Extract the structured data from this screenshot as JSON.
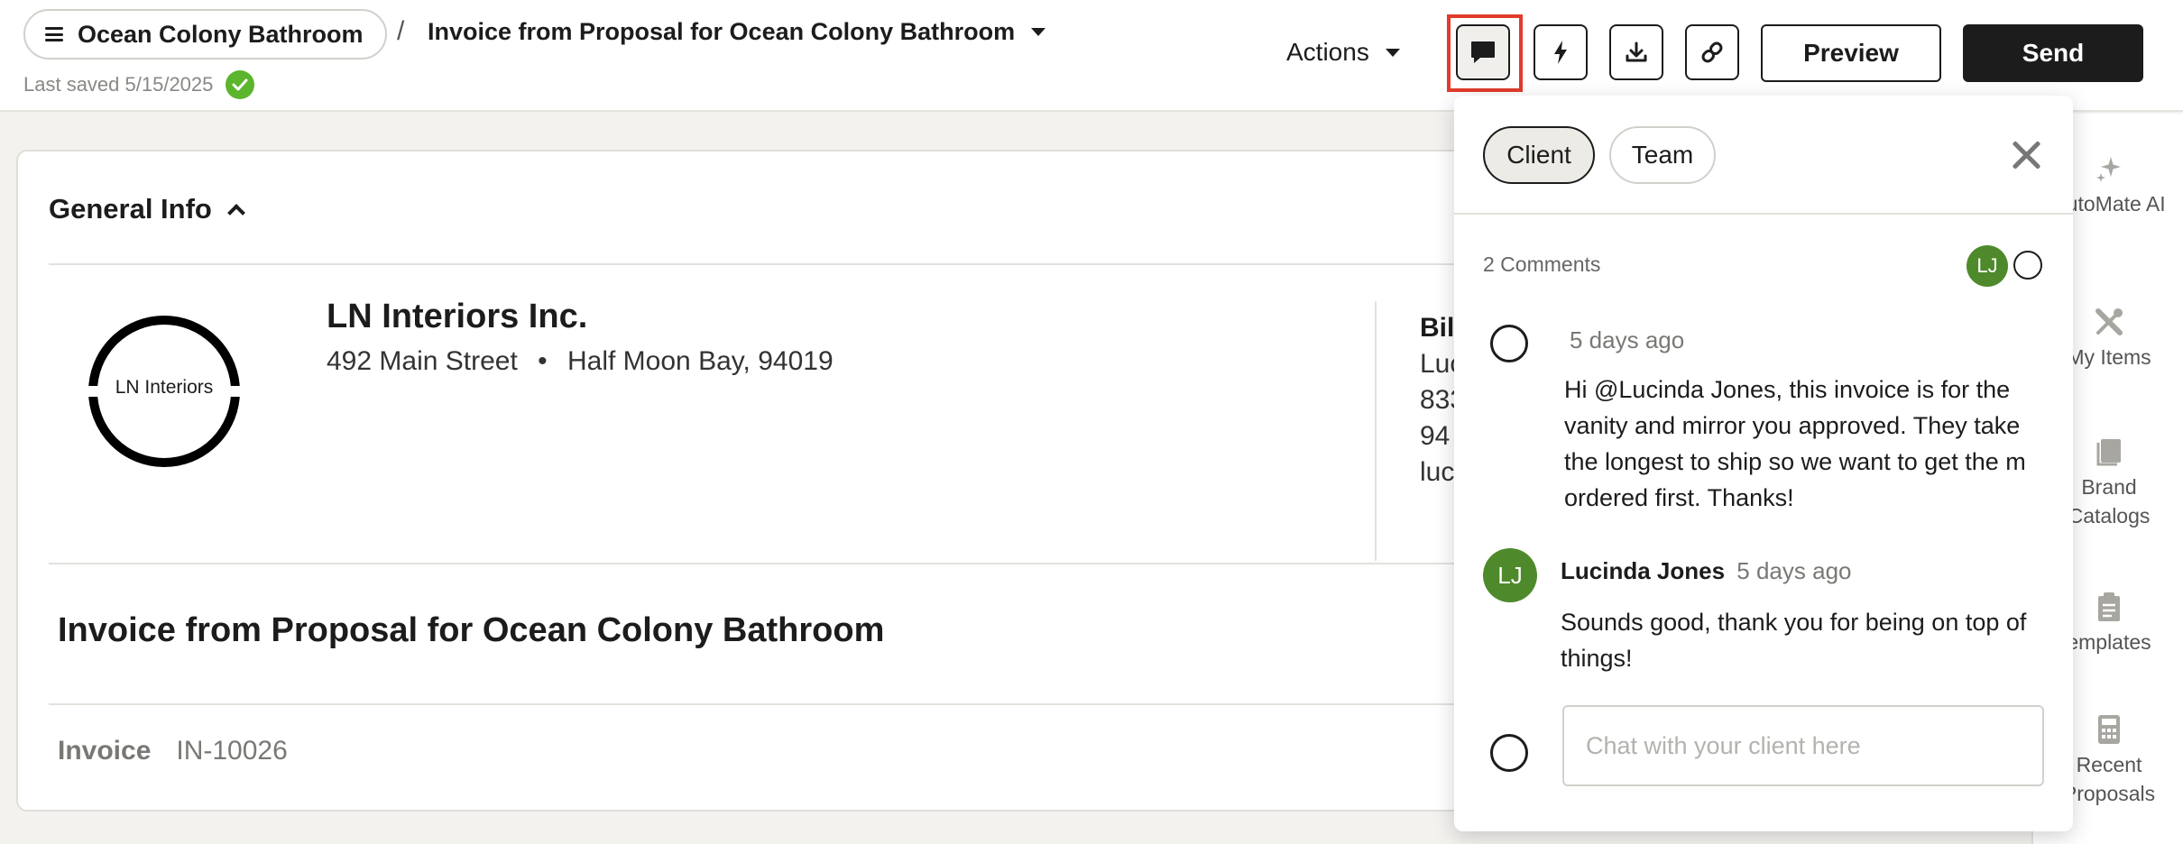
{
  "header": {
    "project_name": "Ocean Colony Bathroom",
    "separator": "/",
    "document_title": "Invoice from Proposal for Ocean Colony Bathroom",
    "last_saved": "Last saved 5/15/2025",
    "actions_label": "Actions",
    "preview_label": "Preview",
    "send_label": "Send"
  },
  "general_info": {
    "section_title": "General Info",
    "logo_text": "LN Interiors",
    "company_name": "LN Interiors Inc.",
    "address_street": "492 Main Street",
    "address_dot": "•",
    "address_city": "Half Moon Bay, 94019",
    "bill_to": {
      "label": "Bill",
      "line1": "Luc",
      "line2": "833",
      "line3": "94",
      "line4": "luc"
    },
    "invoice_title": "Invoice from Proposal for Ocean Colony Bathroom",
    "invoice_label": "Invoice",
    "invoice_number": "IN-10026"
  },
  "rail": {
    "items": [
      {
        "label": "AutoMate AI",
        "icon": "sparkle-icon"
      },
      {
        "label": "My Items",
        "icon": "tools-icon"
      },
      {
        "label": "Brand Catalogs",
        "icon": "book-icon"
      },
      {
        "label": "emplates",
        "icon": "clipboard-icon"
      },
      {
        "label": "Recent Proposals",
        "icon": "calculator-icon"
      }
    ]
  },
  "comments": {
    "tabs": {
      "client": "Client",
      "team": "Team"
    },
    "count_label": "2 Comments",
    "participant_initials": "LJ",
    "items": [
      {
        "author": "",
        "time": "5 days ago",
        "body": "Hi @Lucinda Jones, this invoice is for the vanity and mirror you approved. They take the longest to ship so we want to get the m ordered first. Thanks!"
      },
      {
        "author": "Lucinda Jones",
        "initials": "LJ",
        "time": "5 days ago",
        "body": "Sounds good, thank you for being  on top of things!"
      }
    ],
    "input_placeholder": "Chat with your client here"
  },
  "colors": {
    "accent_dark": "#1c1c1c",
    "avatar_green": "#4e8a2b",
    "saved_check": "#5cb52c",
    "highlight_red": "#e23b2a"
  }
}
